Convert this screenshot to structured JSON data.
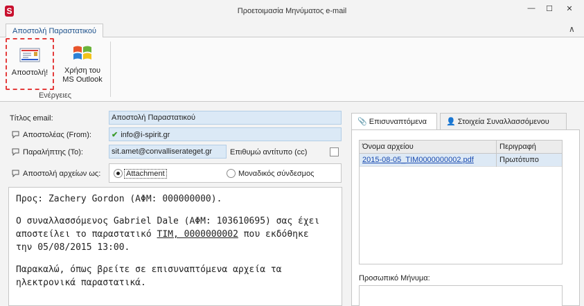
{
  "window": {
    "title": "Προετοιμασία Μηνύματος e-mail",
    "app_icon": "S",
    "min_glyph": "—",
    "max_glyph": "☐",
    "close_glyph": "✕"
  },
  "ribbon": {
    "tab_label": "Αποστολή Παραστατικού",
    "collapse_glyph": "∧",
    "send_label": "Αποστολή!",
    "outlook_label_line1": "Χρήση του",
    "outlook_label_line2": "MS Outlook",
    "group_label": "Ενέργειες"
  },
  "form": {
    "title_label": "Τίτλος email:",
    "title_value": "Αποστολή Παραστατικού",
    "from_label": "Αποστολέας (From):",
    "from_value": "info@i-spirit.gr",
    "to_label": "Παραλήπτης (To):",
    "to_value": "sit.amet@convalliserateget.gr",
    "cc_label": "Επιθυμώ αντίτυπο (cc)",
    "send_files_label": "Αποστολή αρχείων ως:",
    "option_attachment": "Attachment",
    "option_link": "Μοναδικός σύνδεσμος"
  },
  "message": {
    "line1": "Προς: Zachery Gordon (ΑΦΜ: 000000000).",
    "para2_a": "Ο συναλλασσόμενος Gabriel Dale (ΑΦΜ: 103610695) σας έχει",
    "para2_b_pre": "αποστείλει το παραστατικό ",
    "para2_b_link": "ΤΙΜ, 0000000002",
    "para2_b_post": " που εκδόθηκε",
    "para2_c": "την 05/08/2015 13:00.",
    "para3_a": "Παρακαλώ, όπως βρείτε σε επισυναπτόμενα αρχεία τα",
    "para3_b": "ηλεκτρονικά παραστατικά."
  },
  "right_panel": {
    "tab_attachments": "Επισυναπτόμενα",
    "tab_party": "Στοιχεία Συναλλασσόμενου",
    "col_filename": "Όνομα αρχείου",
    "col_description": "Περιγραφή",
    "rows": [
      {
        "filename": "2015-08-05_TIM0000000002.pdf",
        "description": "Πρωτότυπο"
      }
    ],
    "personal_message_label": "Προσωπικό Μήνυμα:"
  }
}
